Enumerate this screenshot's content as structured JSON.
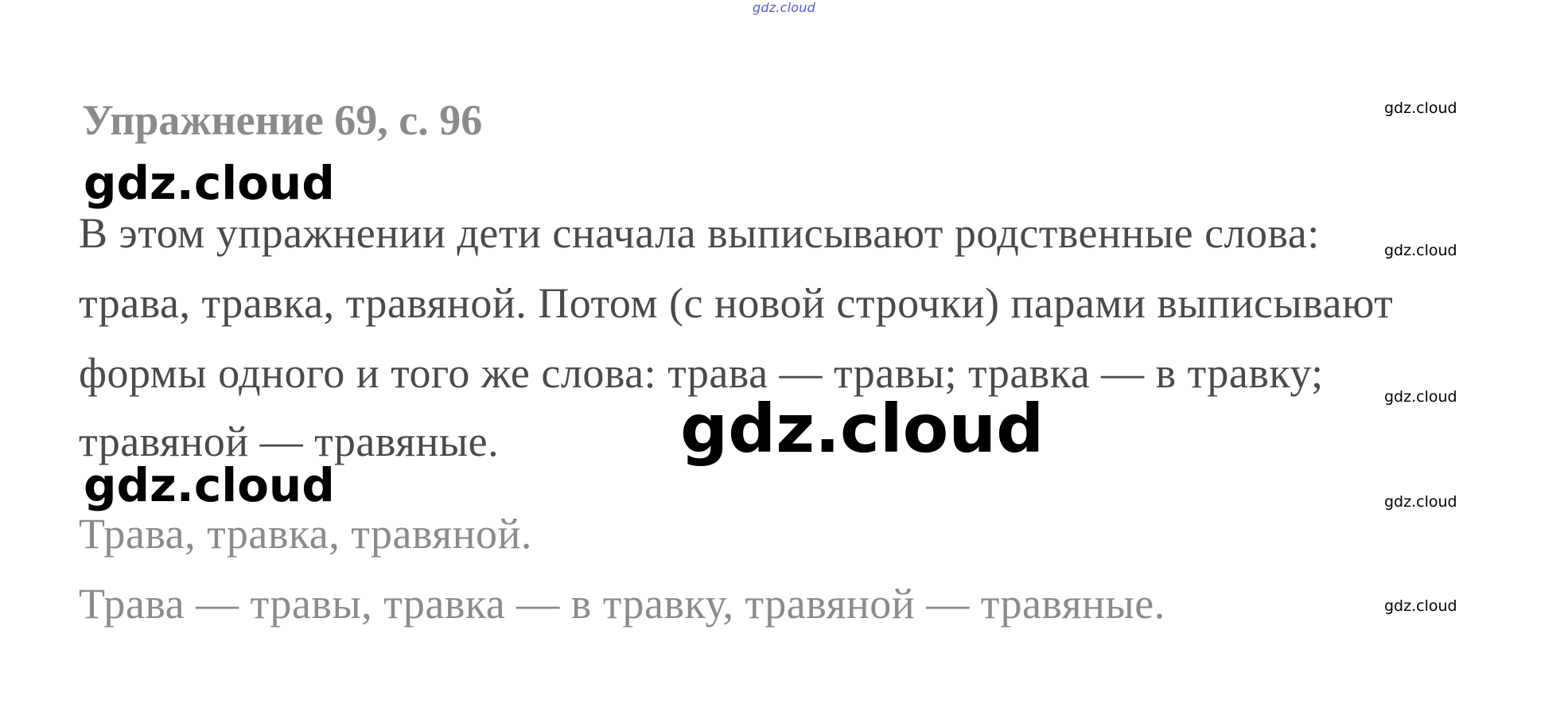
{
  "top_watermark": "gdz.cloud",
  "title": "Упражнение 69, с. 96",
  "body_lines": [
    "В этом упражнении дети сначала выписывают родственные слова:",
    "трава, травка, травяной. Потом (с новой строчки) парами выписывают",
    "формы одного и того же слова: трава — травы; травка — в травку;",
    "травяной — травяные."
  ],
  "answer_lines": [
    "Трава, травка, травяной.",
    "Трава — травы, травка — в травку, травяной — травяные."
  ],
  "watermarks": {
    "left_1": "gdz.cloud",
    "center": "gdz.cloud",
    "left_2": "gdz.cloud",
    "right_1": "gdz.cloud",
    "right_2": "gdz.cloud",
    "right_3": "gdz.cloud",
    "right_4": "gdz.cloud",
    "right_5": "gdz.cloud"
  }
}
